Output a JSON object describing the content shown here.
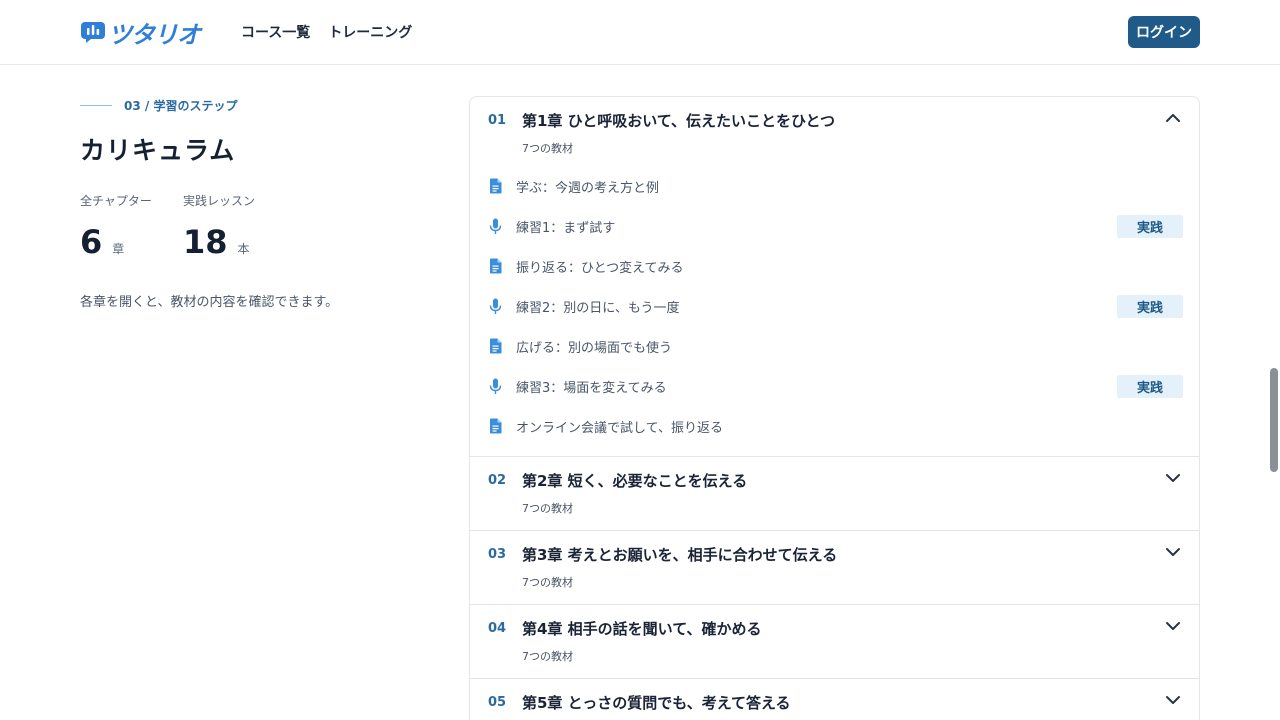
{
  "header": {
    "logo_text": "ツタリオ",
    "nav": [
      "コース一覧",
      "トレーニング"
    ],
    "login_label": "ログイン"
  },
  "section": {
    "eyebrow": "03 / 学習のステップ",
    "title": "カリキュラム",
    "stats": [
      {
        "label": "全チャプター",
        "value": "6",
        "unit": "章"
      },
      {
        "label": "実践レッスン",
        "value": "18",
        "unit": "本"
      }
    ],
    "note": "各章を開くと、教材の内容を確認できます。"
  },
  "chapters": [
    {
      "num": "01",
      "title": "第1章 ひと呼吸おいて、伝えたいことをひとつ",
      "count": "7つの教材",
      "expanded": true,
      "lessons": [
        {
          "icon": "document-icon",
          "label": "学ぶ：今週の考え方と例",
          "badge": ""
        },
        {
          "icon": "microphone-icon",
          "label": "練習1：まず試す",
          "badge": "実践"
        },
        {
          "icon": "document-icon",
          "label": "振り返る：ひとつ変えてみる",
          "badge": ""
        },
        {
          "icon": "microphone-icon",
          "label": "練習2：別の日に、もう一度",
          "badge": "実践"
        },
        {
          "icon": "document-icon",
          "label": "広げる：別の場面でも使う",
          "badge": ""
        },
        {
          "icon": "microphone-icon",
          "label": "練習3：場面を変えてみる",
          "badge": "実践"
        },
        {
          "icon": "document-icon",
          "label": "オンライン会議で試して、振り返る",
          "badge": ""
        }
      ]
    },
    {
      "num": "02",
      "title": "第2章 短く、必要なことを伝える",
      "count": "7つの教材",
      "expanded": false
    },
    {
      "num": "03",
      "title": "第3章 考えとお願いを、相手に合わせて伝える",
      "count": "7つの教材",
      "expanded": false
    },
    {
      "num": "04",
      "title": "第4章 相手の話を聞いて、確かめる",
      "count": "7つの教材",
      "expanded": false
    },
    {
      "num": "05",
      "title": "第5章 とっさの質問でも、考えて答える",
      "count": "",
      "expanded": false
    }
  ],
  "colors": {
    "accent": "#1f5a88",
    "icon": "#3a8fdc",
    "badge_bg": "#e4f1fb"
  }
}
